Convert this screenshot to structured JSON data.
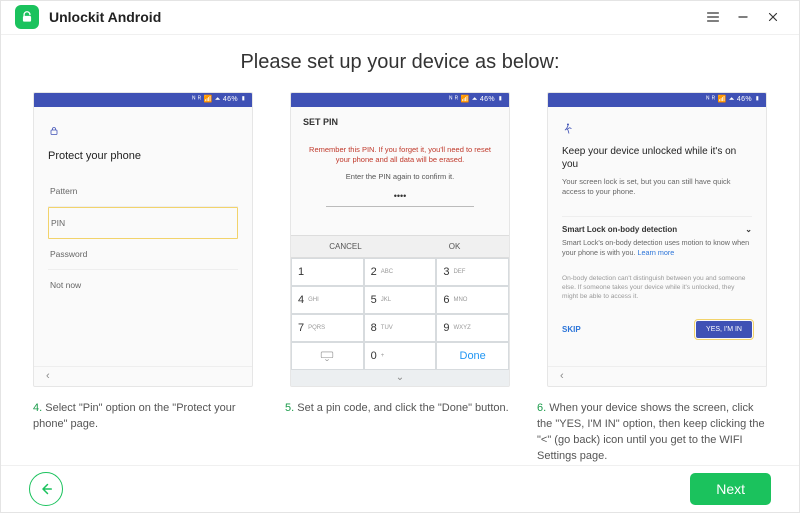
{
  "titlebar": {
    "title": "Unlockit Android"
  },
  "heading": "Please set up your device as below:",
  "status_text": "ᴺ ᴿ 📶 ⏶ 46% ▮",
  "phone1": {
    "title": "Protect your phone",
    "options": [
      "Pattern",
      "PIN",
      "Password",
      "Not now"
    ]
  },
  "phone2": {
    "head": "SET PIN",
    "warn": "Remember this PIN. If you forget it, you'll need to reset your phone and all data will be erased.",
    "sub": "Enter the PIN again to confirm it.",
    "value": "••••",
    "cancel": "CANCEL",
    "ok": "OK",
    "keys": [
      {
        "n": "1",
        "s": ""
      },
      {
        "n": "2",
        "s": "ABC"
      },
      {
        "n": "3",
        "s": "DEF"
      },
      {
        "n": "4",
        "s": "GHI"
      },
      {
        "n": "5",
        "s": "JKL"
      },
      {
        "n": "6",
        "s": "MNO"
      },
      {
        "n": "7",
        "s": "PQRS"
      },
      {
        "n": "8",
        "s": "TUV"
      },
      {
        "n": "9",
        "s": "WXYZ"
      }
    ],
    "done": "Done"
  },
  "phone3": {
    "title": "Keep your device unlocked while it's on you",
    "desc": "Your screen lock is set, but you can still have quick access to your phone.",
    "sec_title": "Smart Lock on-body detection",
    "sec_body": "Smart Lock's on-body detection uses motion to know when your phone is with you.  ",
    "learn": "Learn more",
    "note": "On-body detection can't distinguish between you and someone else. If someone takes your device while it's unlocked, they might be able to access it.",
    "skip": "SKIP",
    "yes": "YES, I'M IN"
  },
  "captions": {
    "c4n": "4.",
    "c4": " Select \"Pin\" option on the \"Protect your phone\" page.",
    "c5n": "5.",
    "c5": " Set a pin code, and click the \"Done\" button.",
    "c6n": "6.",
    "c6": " When your device shows the screen, click the \"YES, I'M IN\" option, then keep clicking the \"<\" (go back) icon until you get to the WIFI Settings page."
  },
  "footer": {
    "next": "Next"
  }
}
